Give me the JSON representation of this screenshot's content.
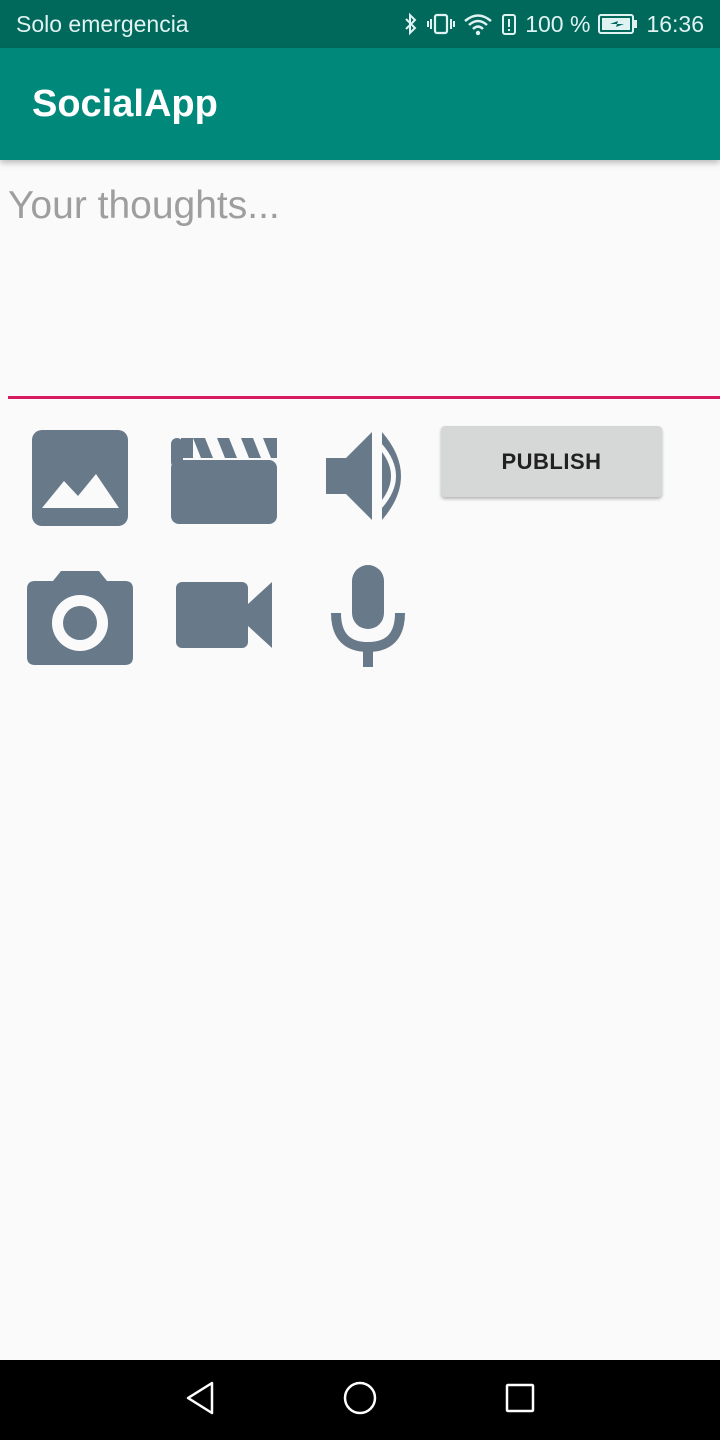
{
  "status_bar": {
    "carrier": "Solo emergencia",
    "battery": "100 %",
    "time": "16:36",
    "icons": [
      "bluetooth-icon",
      "vibrate-icon",
      "wifi-icon",
      "battery-alert-icon",
      "battery-charging-icon"
    ]
  },
  "app_bar": {
    "title": "SocialApp",
    "color": "#00897b"
  },
  "composer": {
    "placeholder": "Your thoughts...",
    "value": "",
    "underline_color": "#d81b60"
  },
  "media_buttons": [
    "image-icon",
    "movie-icon",
    "volume-icon",
    "camera-icon",
    "videocam-icon",
    "mic-icon"
  ],
  "icon_color": "#68798a",
  "actions": {
    "publish_label": "PUBLISH"
  },
  "nav_bar": {
    "buttons": [
      "back-icon",
      "home-icon",
      "recents-icon"
    ]
  }
}
